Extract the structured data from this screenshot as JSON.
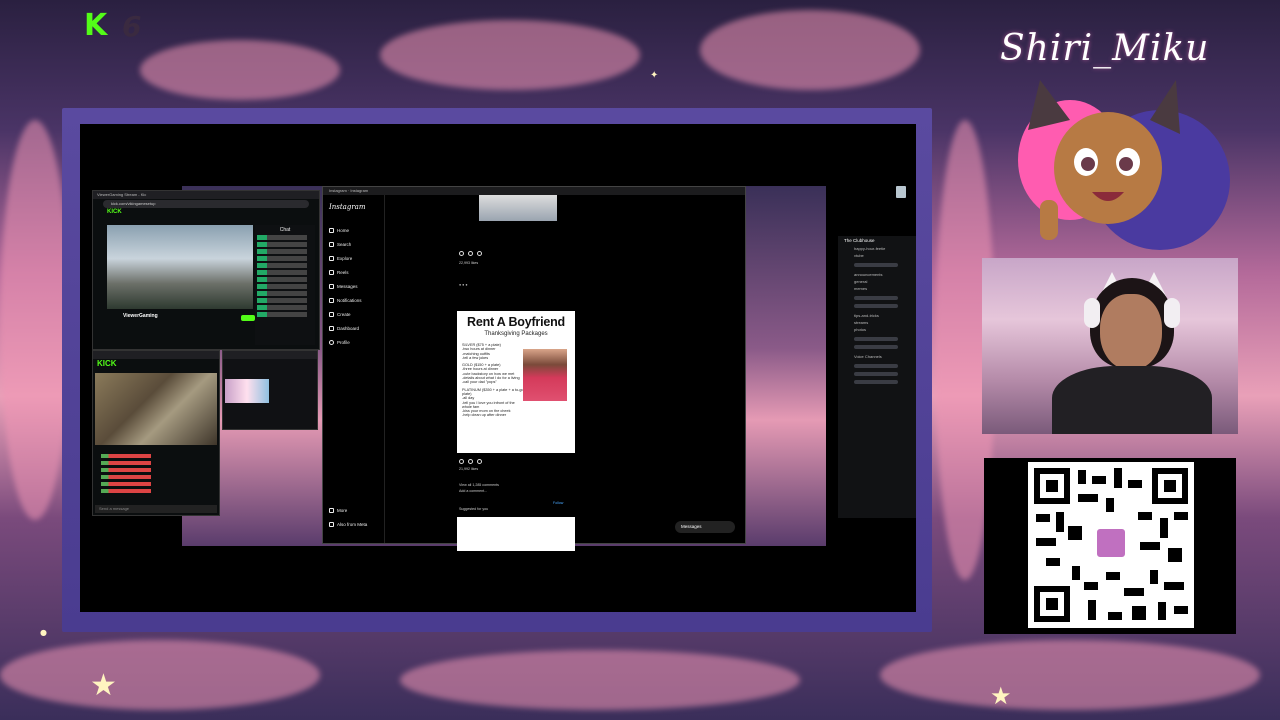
{
  "overlay": {
    "channel_logo_text": "K",
    "channel_logo_number": "6",
    "streamer_name": "Shiri_Miku"
  },
  "kick_window": {
    "tab_title": "ViewerGaming Stream - Kic",
    "url": "kick.com/vikingamesetup",
    "brand": "KICK",
    "chat_header": "Chat",
    "streamer": "ViewerGaming",
    "follow_label": "Follow"
  },
  "kick_mini_window": {
    "brand": "KICK",
    "chat_input_placeholder": "Send a message"
  },
  "instagram": {
    "window_title": "Instagram · Instagram",
    "logo": "Instagram",
    "nav": [
      "Home",
      "Search",
      "Explore",
      "Reels",
      "Messages",
      "Notifications",
      "Create",
      "Dashboard",
      "Profile"
    ],
    "more_label": "More",
    "also_from_meta": "Also from Meta",
    "likes_top": "22,993 likes",
    "post_title": "Rent A Boyfriend",
    "post_subtitle": "Thanksgiving Packages",
    "tiers": [
      {
        "name": "SILVER ($75 + a plate)",
        "items": [
          "-two hours at dinner",
          "-matching outfits",
          "-tell a few jokes"
        ]
      },
      {
        "name": "GOLD ($150 + a plate)",
        "items": [
          "-three hours at dinner",
          "-cute backstory on how we met",
          "-details about what I do for a living",
          "-call your dad \"pops\""
        ]
      },
      {
        "name": "PLATINUM ($350 + a plate + a to-go plate)",
        "items": [
          "-all day",
          "-tell you I love you infront of the whole fam",
          "-kiss your mom on the cheek",
          "-help clean up after dinner"
        ]
      }
    ],
    "likes_post": "21,992 likes",
    "comments_link": "View all 1,285 comments",
    "add_comment": "Add a comment...",
    "suggested": "Suggested for you",
    "follow_label": "Follow",
    "messages_label": "Messages"
  },
  "side_panel": {
    "server_name": "The Clubhouse",
    "channels": [
      "happy-hour-feetie",
      "vtube",
      "announcements",
      "general",
      "memes",
      "tips-and-tricks",
      "streams",
      "photos"
    ],
    "voice_label": "Voice Channels"
  }
}
